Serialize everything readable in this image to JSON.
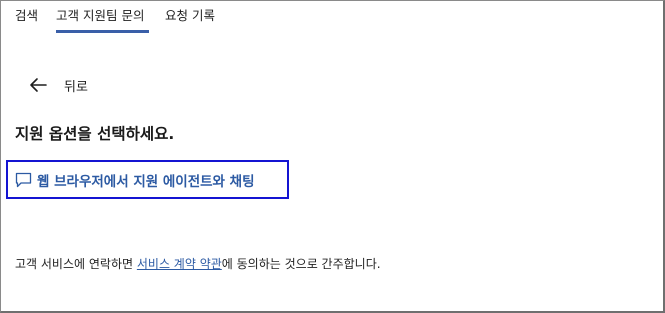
{
  "tabs": [
    {
      "label": "검색"
    },
    {
      "label": "고객 지원팀 문의"
    },
    {
      "label": "요청 기록"
    }
  ],
  "back": {
    "label": "뒤로",
    "icon": "back-arrow-icon"
  },
  "heading": "지원 옵션을 선택하세요.",
  "chat_option": {
    "label": "웹 브라우저에서 지원 에이전트와 채팅",
    "icon": "chat-bubble-icon"
  },
  "terms": {
    "prefix": "고객 서비스에 연락하면 ",
    "link": "서비스 계약 약관",
    "suffix": "에 동의하는 것으로 간주합니다."
  },
  "colors": {
    "accent": "#3a5fa8",
    "link": "#2c5aa3",
    "focus_border": "#1414d2"
  }
}
